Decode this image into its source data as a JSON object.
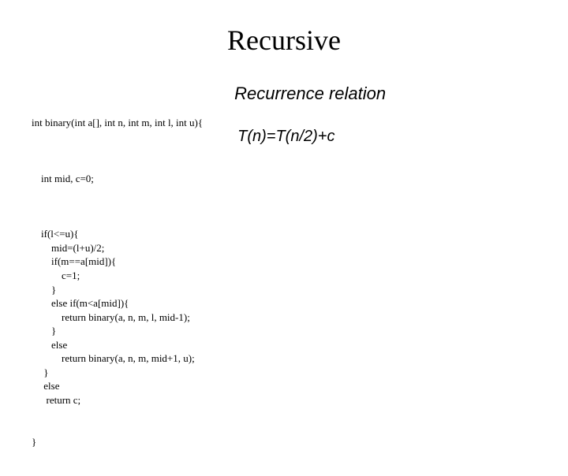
{
  "title": "Recursive",
  "code": {
    "signature": "int binary(int a[], int n, int m, int l, int u){",
    "decl": "int mid, c=0;",
    "body": "if(l<=u){\n    mid=(l+u)/2;\n    if(m==a[mid]){\n        c=1;\n    }\n    else if(m<a[mid]){\n        return binary(a, n, m, l, mid-1);\n    }\n    else\n        return binary(a, n, m, mid+1, u);\n }\n else\n  return c;",
    "close": "}"
  },
  "right": {
    "heading": "Recurrence relation",
    "formula": "T(n)=T(n/2)+c"
  }
}
